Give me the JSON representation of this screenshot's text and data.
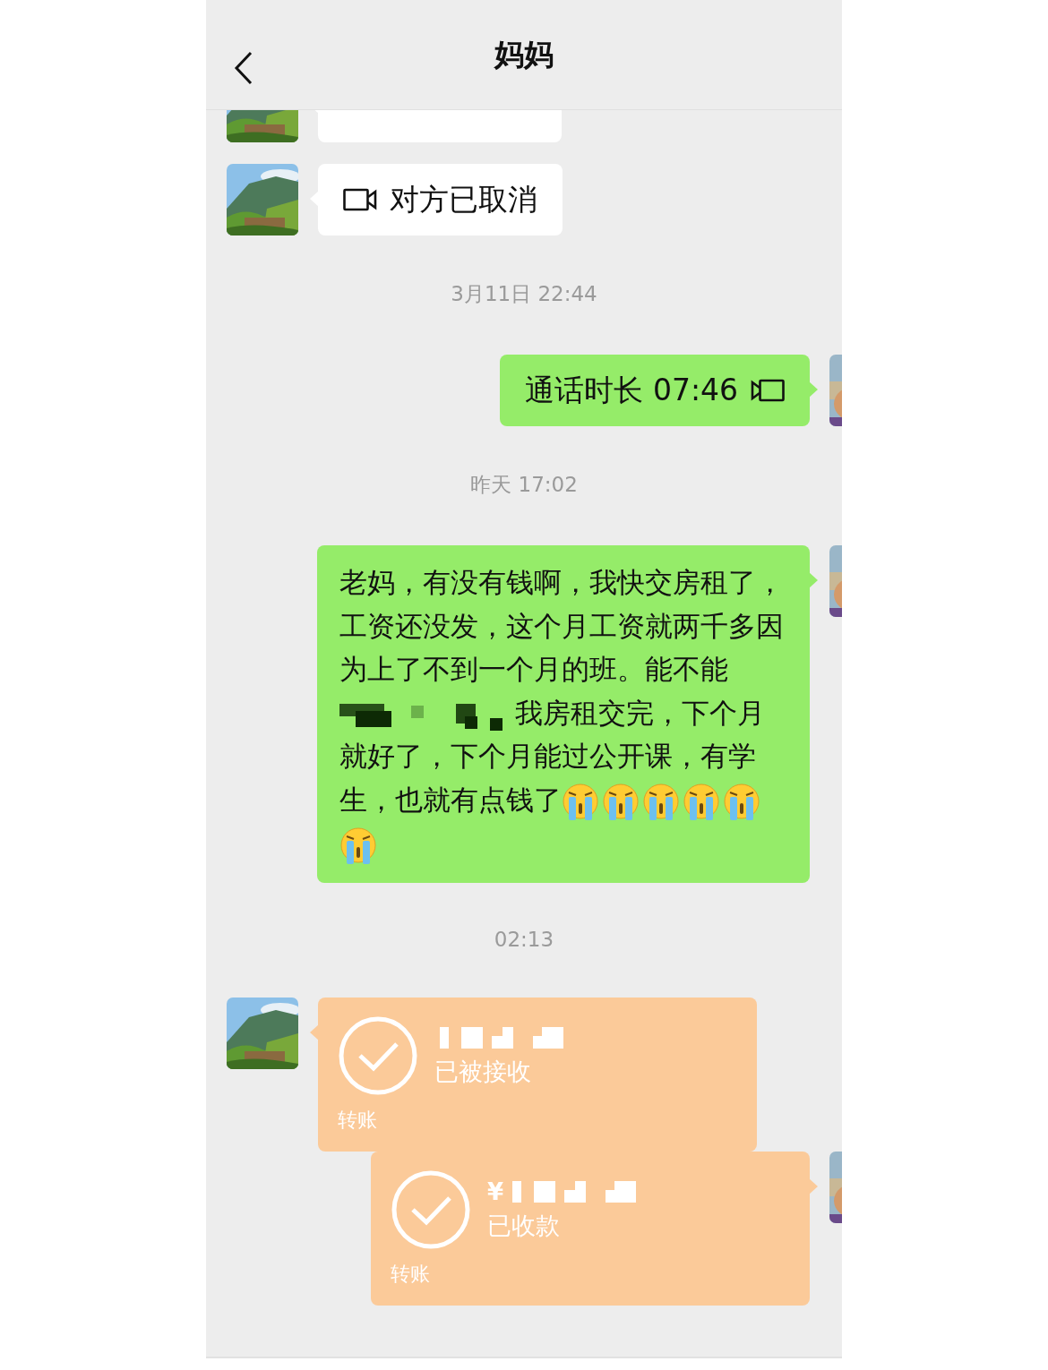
{
  "header": {
    "title": "妈妈"
  },
  "messages": [
    {
      "kind": "cut",
      "outgoing": false
    },
    {
      "kind": "call",
      "outgoing": false,
      "text": "对方已取消"
    },
    {
      "kind": "time",
      "text": "3月11日 22:44"
    },
    {
      "kind": "call",
      "outgoing": true,
      "text": "通话时长 07:46"
    },
    {
      "kind": "time",
      "text": "昨天 17:02"
    },
    {
      "kind": "text",
      "outgoing": true,
      "parts": [
        {
          "kind": "text",
          "text": "老妈，有没有钱啊，我快交房租了，工资还没发，这个月工资就两千多因为上了不到一个月的班。能不能"
        },
        {
          "kind": "redacted"
        },
        {
          "kind": "text",
          "text": "我房租交完，下个月"
        },
        {
          "kind": "line",
          "text": "就好了，下个月能过公开课，有学"
        },
        {
          "kind": "text",
          "text": "生，也就有点钱了"
        },
        {
          "kind": "emoji"
        },
        {
          "kind": "emoji"
        },
        {
          "kind": "emoji"
        },
        {
          "kind": "emoji"
        },
        {
          "kind": "emoji"
        },
        {
          "kind": "emoji"
        }
      ]
    },
    {
      "kind": "time",
      "text": "02:13"
    },
    {
      "kind": "transfer",
      "outgoing": false,
      "status": "已被接收",
      "label": "转账"
    },
    {
      "kind": "transfer",
      "outgoing": true,
      "currency": "¥",
      "status": "已收款",
      "label": "转账"
    }
  ]
}
